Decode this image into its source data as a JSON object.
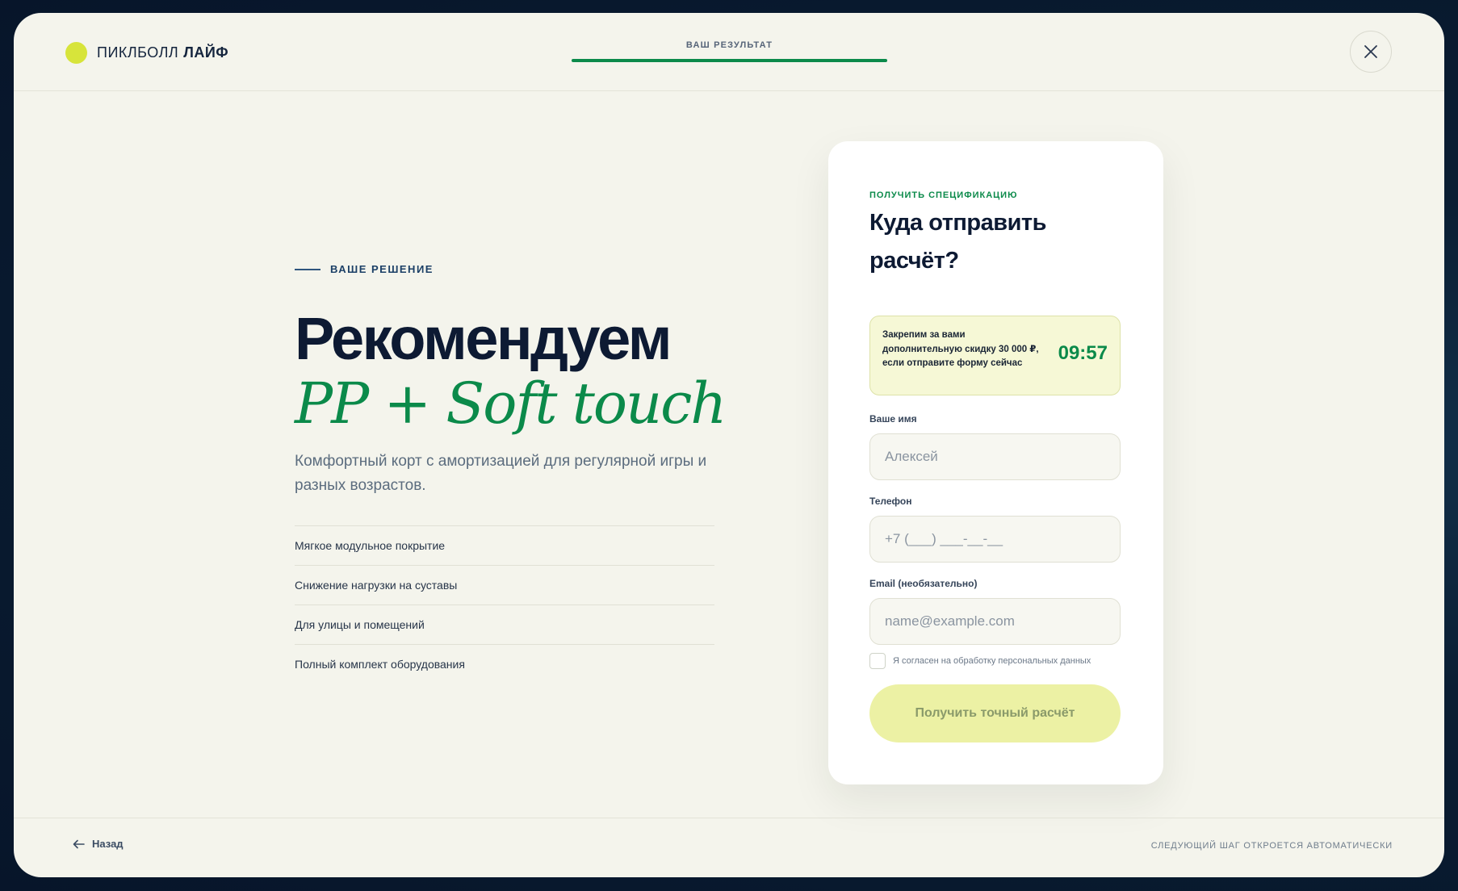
{
  "header": {
    "brand_regular": "ПИКЛБОЛЛ",
    "brand_bold": "ЛАЙФ",
    "progress_label": "ВАШ РЕЗУЛЬТАТ",
    "progress_fraction": 1.0
  },
  "solution": {
    "eyebrow": "ВАШЕ РЕШЕНИЕ",
    "title": "Рекомендуем",
    "product": "PP + Soft touch",
    "description": "Комфортный корт с амортизацией для регулярной игры и разных возрастов.",
    "features": [
      "Мягкое модульное покрытие",
      "Снижение нагрузки на суставы",
      "Для улицы и помещений",
      "Полный комплект оборудования"
    ]
  },
  "form": {
    "eyebrow": "ПОЛУЧИТЬ СПЕЦИФИКАЦИЮ",
    "title": "Куда отправить расчёт?",
    "promo_text": "Закрепим за вами дополнительную скидку 30 000 ₽, если отправите форму сейчас",
    "timer": "09:57",
    "name_label": "Ваше имя",
    "name_placeholder": "Алексей",
    "phone_label": "Телефон",
    "phone_placeholder": "+7 (___) ___-__-__",
    "email_label": "Email (необязательно)",
    "email_placeholder": "name@example.com",
    "consent": "Я согласен на обработку персональных данных",
    "submit": "Получить точный расчёт"
  },
  "footer": {
    "back": "Назад",
    "note": "СЛЕДУЮЩИЙ ШАГ ОТКРОЕТСЯ АВТОМАТИЧЕСКИ"
  },
  "icons": {
    "logo": "logo-dot-icon",
    "close": "close-icon",
    "back": "arrow-left-icon"
  },
  "colors": {
    "accent_green": "#0b8a4a",
    "logo_yellow": "#d7e43a",
    "background": "#f4f4ec",
    "navy": "#0d1a33"
  }
}
